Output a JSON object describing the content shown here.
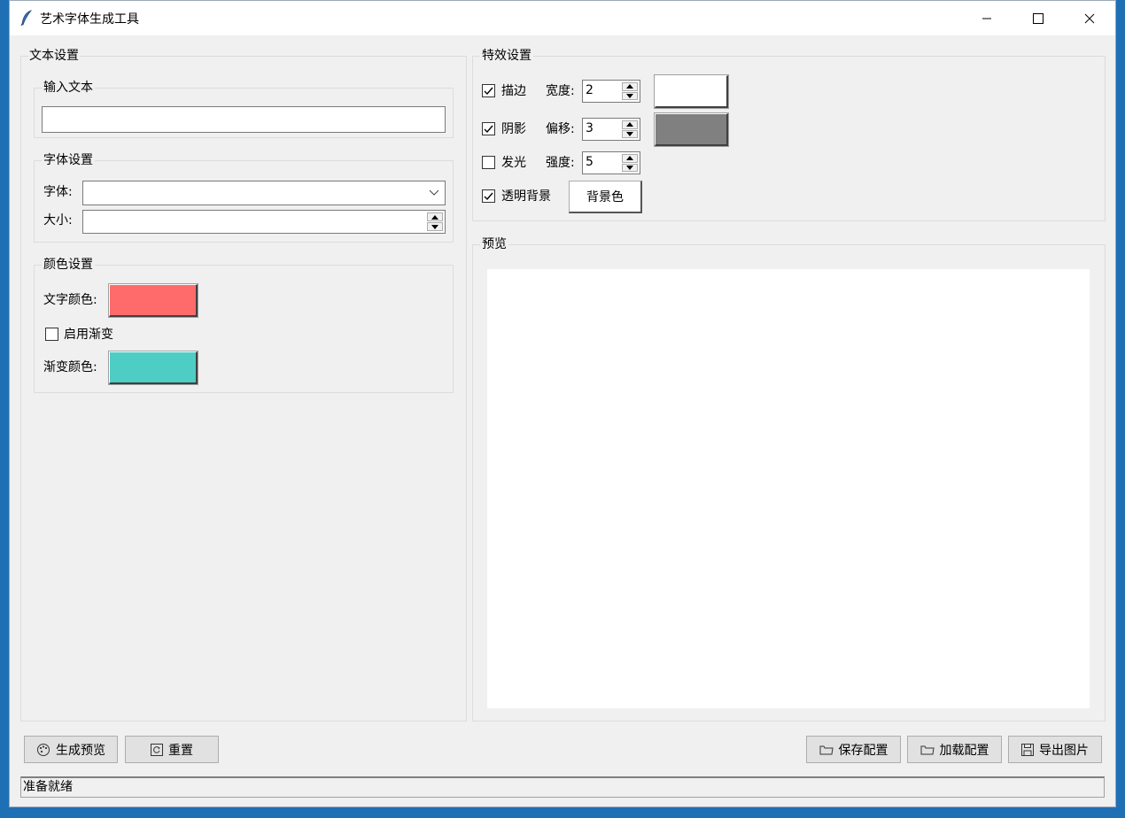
{
  "window": {
    "title": "艺术字体生成工具",
    "icon": "feather-icon"
  },
  "text_settings": {
    "title": "文本设置",
    "input_group": {
      "title": "输入文本",
      "value": ""
    },
    "font_group": {
      "title": "字体设置",
      "font_label": "字体:",
      "font_value": "",
      "size_label": "大小:",
      "size_value": ""
    },
    "color_group": {
      "title": "颜色设置",
      "text_color_label": "文字颜色:",
      "text_color": "#ff6b6b",
      "gradient_label": "启用渐变",
      "gradient_checked": false,
      "gradient_color_label": "渐变颜色:",
      "gradient_color": "#4ecdc4"
    }
  },
  "effects": {
    "title": "特效设置",
    "stroke": {
      "label": "描边",
      "checked": true,
      "param_label": "宽度:",
      "value": "2",
      "color": "#ffffff"
    },
    "shadow": {
      "label": "阴影",
      "checked": true,
      "param_label": "偏移:",
      "value": "3",
      "color": "#808080"
    },
    "glow": {
      "label": "发光",
      "checked": false,
      "param_label": "强度:",
      "value": "5"
    },
    "transparent_bg": {
      "label": "透明背景",
      "checked": true,
      "bg_button": "背景色"
    }
  },
  "preview": {
    "title": "预览"
  },
  "bottom_buttons": {
    "generate": {
      "label": "生成预览",
      "icon": "palette-icon"
    },
    "reset": {
      "label": "重置",
      "icon": "reset-icon"
    },
    "save": {
      "label": "保存配置",
      "icon": "folder-icon"
    },
    "load": {
      "label": "加载配置",
      "icon": "folder-icon"
    },
    "export": {
      "label": "导出图片",
      "icon": "save-icon"
    }
  },
  "status": "准备就绪"
}
